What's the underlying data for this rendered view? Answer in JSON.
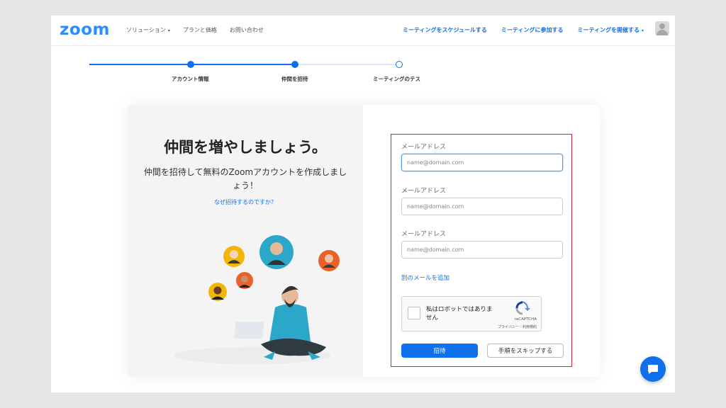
{
  "header": {
    "logo": "zoom",
    "nav_left": [
      {
        "label": "ソリューション",
        "caret": "▾"
      },
      {
        "label": "プランと価格"
      },
      {
        "label": "お問い合わせ"
      }
    ],
    "nav_right": [
      {
        "label": "ミーティングをスケジュールする"
      },
      {
        "label": "ミーティングに参加する"
      },
      {
        "label": "ミーティングを開催する",
        "caret": "▾"
      }
    ]
  },
  "stepper": {
    "steps": [
      {
        "label": "アカウント情報",
        "state": "completed"
      },
      {
        "label": "仲間を招待",
        "state": "current"
      },
      {
        "label": "ミーティングのテス",
        "state": "upcoming"
      }
    ]
  },
  "invite": {
    "title": "仲間を増やしましょう。",
    "subtitle": "仲間を招待して無料のZoomアカウントを作成しましょう！",
    "why_link": "なぜ招待するのですか？"
  },
  "form": {
    "fields": [
      {
        "label": "メールアドレス",
        "placeholder": "name@domain.com",
        "value": ""
      },
      {
        "label": "メールアドレス",
        "placeholder": "name@domain.com",
        "value": ""
      },
      {
        "label": "メールアドレス",
        "placeholder": "name@domain.com",
        "value": ""
      }
    ],
    "add_email": "別のメールを追加",
    "recaptcha": {
      "text": "私はロボットではありません",
      "brand": "reCAPTCHA",
      "terms": "プライバシー - 利用規約"
    },
    "invite_button": "招待",
    "skip_button": "手順をスキップする"
  },
  "colors": {
    "accent": "#0e71eb",
    "logo": "#2d8cff",
    "highlight_border": "#d3272c"
  },
  "icons": {
    "avatar": "user-avatar-icon",
    "chat": "chat-bubble-icon",
    "recaptcha": "recaptcha-logo-icon"
  }
}
